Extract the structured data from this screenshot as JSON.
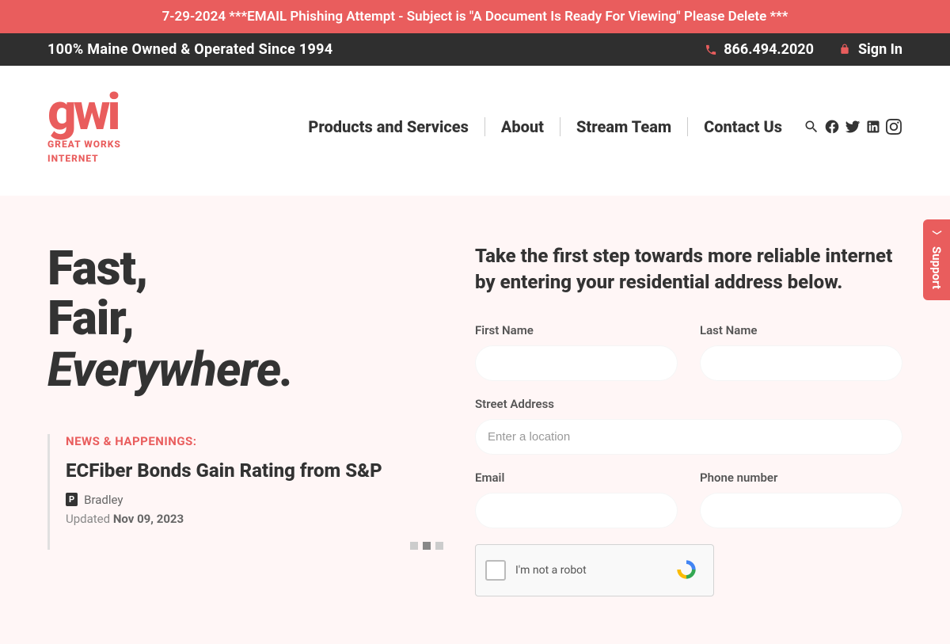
{
  "announcement": "7-29-2024 ***EMAIL Phishing Attempt - Subject is \"A Document Is Ready For Viewing\" Please Delete ***",
  "infobar": {
    "tagline": "100% Maine Owned & Operated Since 1994",
    "phone": "866.494.2020",
    "signin": "Sign In"
  },
  "logo": {
    "mark": "gwi",
    "sub1": "GREAT WORKS",
    "sub2": "INTERNET"
  },
  "nav": {
    "products": "Products and Services",
    "about": "About",
    "stream": "Stream Team",
    "contact": "Contact Us"
  },
  "hero": {
    "line1": "Fast,",
    "line2": "Fair,",
    "line3": "Everywhere."
  },
  "news": {
    "label": "NEWS & HAPPENINGS:",
    "headline": "ECFiber Bonds Gain Rating from S&P",
    "badge": "P",
    "author": "Bradley",
    "updated_prefix": "Updated ",
    "updated_date": "Nov 09, 2023"
  },
  "form": {
    "title": "Take the first step towards more reliable internet by entering your residential address below.",
    "first_name_label": "First Name",
    "last_name_label": "Last Name",
    "street_label": "Street Address",
    "street_placeholder": "Enter a location",
    "email_label": "Email",
    "phone_label": "Phone number"
  },
  "recaptcha": {
    "label": "I'm not a robot"
  },
  "support_tab": "Support",
  "colors": {
    "accent": "#e95d5d",
    "dark": "#2f2f2f",
    "hero_bg": "#fff6f6"
  }
}
